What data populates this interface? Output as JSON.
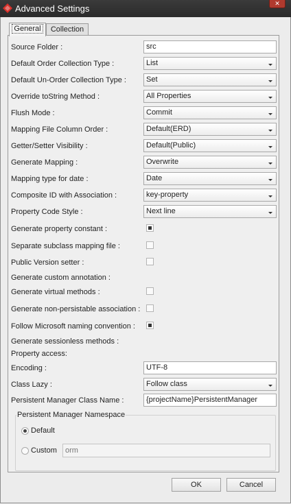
{
  "window": {
    "title": "Advanced Settings",
    "close_glyph": "✕"
  },
  "tabs": [
    {
      "label": "General"
    },
    {
      "label": "Collection"
    }
  ],
  "form": {
    "source_folder": {
      "label": "Source Folder :",
      "value": "src"
    },
    "default_order_collection_type": {
      "label": "Default Order Collection Type :",
      "value": "List"
    },
    "default_unorder_collection_type": {
      "label": "Default Un-Order Collection Type :",
      "value": "Set"
    },
    "override_tostring": {
      "label": "Override toString Method :",
      "value": "All Properties"
    },
    "flush_mode": {
      "label": "Flush Mode :",
      "value": "Commit"
    },
    "mapping_file_column_order": {
      "label": "Mapping File Column Order :",
      "value": "Default(ERD)"
    },
    "getter_setter_visibility": {
      "label": "Getter/Setter Visibility :",
      "value": "Default(Public)"
    },
    "generate_mapping": {
      "label": "Generate Mapping :",
      "value": "Overwrite"
    },
    "mapping_type_for_date": {
      "label": "Mapping type for date :",
      "value": "Date"
    },
    "composite_id": {
      "label": "Composite ID with Association :",
      "value": "key-property"
    },
    "property_code_style": {
      "label": "Property Code Style :",
      "value": "Next line"
    },
    "generate_property_constant": {
      "label": "Generate property constant :",
      "checked": true
    },
    "separate_subclass_mapping": {
      "label": "Separate subclass mapping file :",
      "checked": false
    },
    "public_version_setter": {
      "label": "Public Version setter :",
      "checked": false
    },
    "generate_custom_annotation": {
      "label": "Generate custom annotation :"
    },
    "generate_virtual_methods": {
      "label": "Generate virtual methods :",
      "checked": false
    },
    "generate_non_persistable": {
      "label": "Generate non-persistable association :",
      "checked": false
    },
    "follow_microsoft_naming": {
      "label": "Follow Microsoft naming convention :",
      "checked": true
    },
    "generate_sessionless_methods": {
      "label": "Generate sessionless methods :"
    },
    "property_access": {
      "label": "Property access:"
    },
    "encoding": {
      "label": "Encoding :",
      "value": "UTF-8"
    },
    "class_lazy": {
      "label": "Class Lazy :",
      "value": "Follow class"
    },
    "persistent_manager_class_name": {
      "label": "Persistent Manager Class Name :",
      "value": "{projectName}PersistentManager"
    }
  },
  "namespace": {
    "title": "Persistent Manager Namespace",
    "default_label": "Default",
    "custom_label": "Custom",
    "custom_placeholder": "orm",
    "selected": "Default"
  },
  "buttons": {
    "ok": "OK",
    "cancel": "Cancel"
  }
}
